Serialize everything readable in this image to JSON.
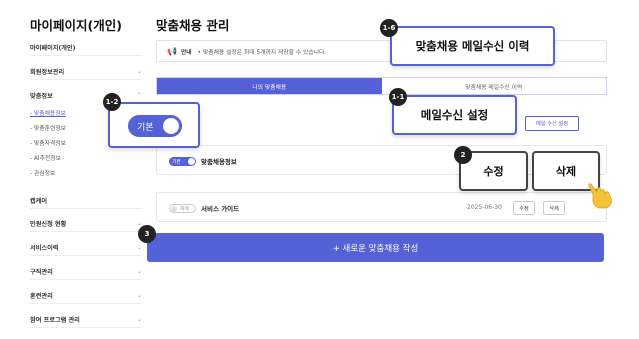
{
  "sidebar": {
    "title": "마이페이지(개인)",
    "items": [
      {
        "label": "마이페이지(개인)"
      },
      {
        "label": "회원정보관리"
      },
      {
        "label": "맞춤정보"
      },
      {
        "label": "캡케어"
      },
      {
        "label": "민원신청 현황"
      },
      {
        "label": "서비스이력"
      },
      {
        "label": "구직관리"
      },
      {
        "label": "훈련관리"
      },
      {
        "label": "참여 프로그램 관리"
      }
    ],
    "subitems": [
      {
        "label": "- 맞춤채용정보"
      },
      {
        "label": "- 맞춤훈련정보"
      },
      {
        "label": "- 맞춤자격정보"
      },
      {
        "label": "- AI추천정보"
      },
      {
        "label": "- 관심정보"
      }
    ]
  },
  "main": {
    "title": "맞춤채용 관리",
    "notice": {
      "label": "안내",
      "text": "• 맞춤채용 설정은 최대 5개까지 저장할 수 있습니다."
    },
    "tabs": [
      {
        "label": "나의 맞춤채용"
      },
      {
        "label": "맞춤채용 메일수신 이력"
      }
    ],
    "setting_button": "메일 수신 설정",
    "cards": [
      {
        "toggle": "기본",
        "name": "맞춤채용정보",
        "date": ""
      },
      {
        "toggle": "해제",
        "name": "서비스 가이드",
        "date": "2025-06-30"
      }
    ],
    "edit_button": "수정",
    "delete_button": "삭제",
    "create_button": "+ 새로운 맞춤채용 작성"
  },
  "callouts": {
    "mail_history": {
      "badge": "1-6",
      "label": "맞춤채용 메일수신 이력"
    },
    "mail_setting": {
      "badge": "1-1",
      "label": "메일수신 설정"
    },
    "default_toggle": {
      "badge": "1-2",
      "label": "기본"
    },
    "edit": {
      "badge": "2",
      "label": "수정"
    },
    "delete": {
      "label": "삭제"
    },
    "create": {
      "badge": "3"
    }
  },
  "colors": {
    "accent": "#5561d6",
    "badge": "#222222"
  }
}
